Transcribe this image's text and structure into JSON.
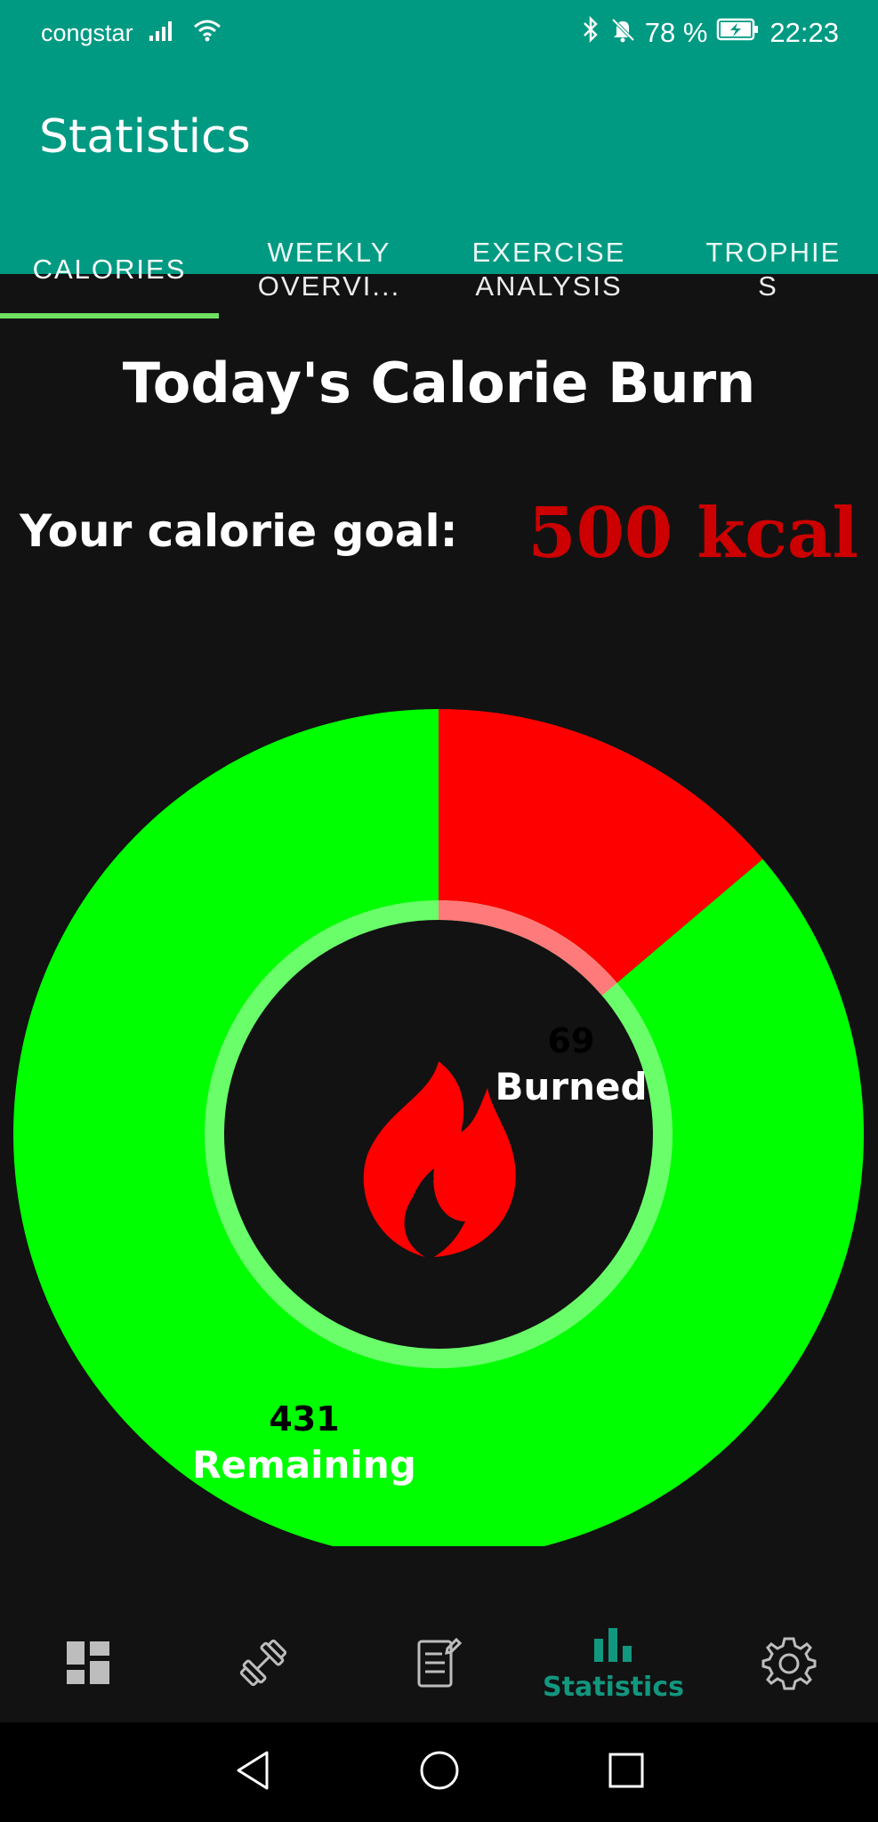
{
  "status_bar": {
    "carrier": "congstar",
    "battery": "78 %",
    "time": "22:23"
  },
  "app_bar": {
    "title": "Statistics"
  },
  "tabs": [
    {
      "label": "CALORIES",
      "active": true
    },
    {
      "label": "WEEKLY OVERVI...",
      "active": false
    },
    {
      "label": "EXERCISE ANALYSIS",
      "active": false
    },
    {
      "label": "TROPHIE S",
      "active": false
    }
  ],
  "main": {
    "heading": "Today's Calorie Burn",
    "goal_label": "Your calorie goal:",
    "goal_value": "500 kcal"
  },
  "chart_data": {
    "type": "pie",
    "variant": "donut",
    "categories": [
      "Burned",
      "Remaining"
    ],
    "values": [
      69,
      431
    ],
    "colors": [
      "#ff0000",
      "#00ff00"
    ],
    "labels": [
      {
        "value": "69",
        "name": "Burned"
      },
      {
        "value": "431",
        "name": "Remaining"
      }
    ],
    "center_icon": "flame-icon"
  },
  "bottom_nav": {
    "items": [
      {
        "icon": "dashboard-icon",
        "label": "",
        "active": false
      },
      {
        "icon": "dumbbell-icon",
        "label": "",
        "active": false
      },
      {
        "icon": "notes-icon",
        "label": "",
        "active": false
      },
      {
        "icon": "bar-chart-icon",
        "label": "Statistics",
        "active": true
      },
      {
        "icon": "gear-icon",
        "label": "",
        "active": false
      }
    ]
  },
  "colors": {
    "primary": "#009a82",
    "active_tab_indicator": "#6fe05f",
    "goal_value": "#cc0000",
    "nav_active": "#12977f",
    "background": "#121212"
  }
}
